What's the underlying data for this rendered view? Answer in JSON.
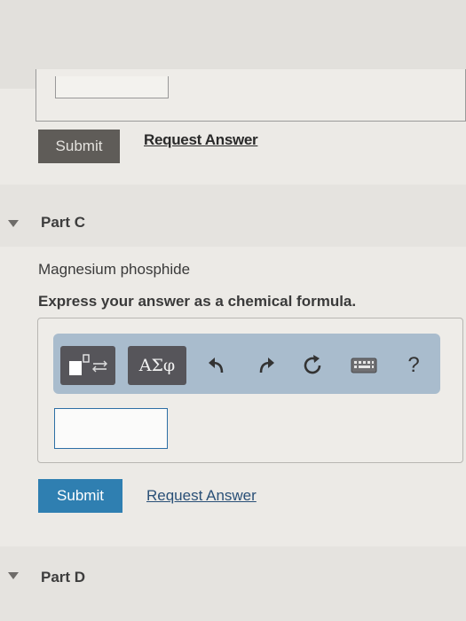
{
  "part_b": {
    "submit_label": "Submit",
    "request_answer_label": "Request Answer"
  },
  "part_c": {
    "label": "Part C",
    "question": "Magnesium phosphide",
    "instruction": "Express your answer as a chemical formula.",
    "toolbar": {
      "greek_label": "ΑΣφ",
      "help_label": "?"
    },
    "answer_value": "",
    "submit_label": "Submit",
    "request_answer_label": "Request Answer"
  },
  "part_d": {
    "label": "Part D"
  },
  "colors": {
    "submit_active": "#2f7fb1",
    "submit_disabled": "#5f5c58",
    "link": "#2a5077",
    "toolbar_bg": "#a9bccd"
  },
  "icons": [
    "templates-icon",
    "undo-icon",
    "redo-icon",
    "reset-icon",
    "keyboard-icon",
    "help-icon",
    "collapse-caret-icon"
  ]
}
